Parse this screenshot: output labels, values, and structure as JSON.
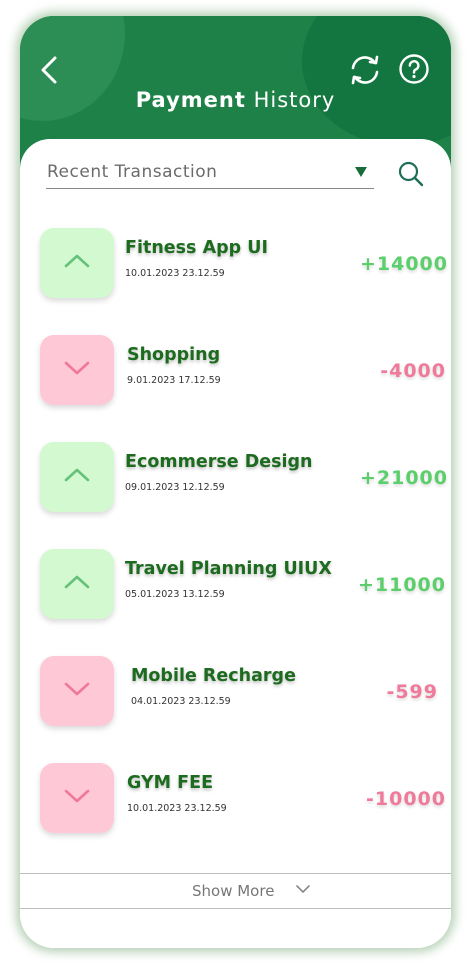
{
  "header": {
    "title_bold": "Payment",
    "title_rest": "History",
    "back_icon": "chevron-left-icon",
    "refresh_icon": "refresh-icon",
    "help_icon": "help-icon"
  },
  "filter": {
    "label": "Recent Transaction",
    "dropdown_icon": "caret-down-icon",
    "search_icon": "search-icon"
  },
  "colors": {
    "header": "#1e8148",
    "income_bg": "#d2f9cf",
    "expense_bg": "#ffc8d6",
    "income_text": "#5ccf6c",
    "expense_text": "#f07a9c",
    "name_text": "#1d6b1e"
  },
  "transactions": [
    {
      "name": "Fitness App UI",
      "date": "10.01.2023  23.12.59",
      "amount": "+14000",
      "direction": "up"
    },
    {
      "name": "Shopping",
      "date": "9.01.2023  17.12.59",
      "amount": "-4000",
      "direction": "down"
    },
    {
      "name": "Ecommerse Design",
      "date": "09.01.2023  12.12.59",
      "amount": "+21000",
      "direction": "up"
    },
    {
      "name": "Travel Planning UIUX",
      "date": "05.01.2023  13.12.59",
      "amount": "+11000",
      "direction": "up"
    },
    {
      "name": "Mobile Recharge",
      "date": "04.01.2023  23.12.59",
      "amount": "-599",
      "direction": "down"
    },
    {
      "name": "GYM FEE",
      "date": "10.01.2023  23.12.59",
      "amount": "-10000",
      "direction": "down"
    }
  ],
  "footer": {
    "show_more": "Show More",
    "show_more_icon": "chevron-down-icon"
  }
}
